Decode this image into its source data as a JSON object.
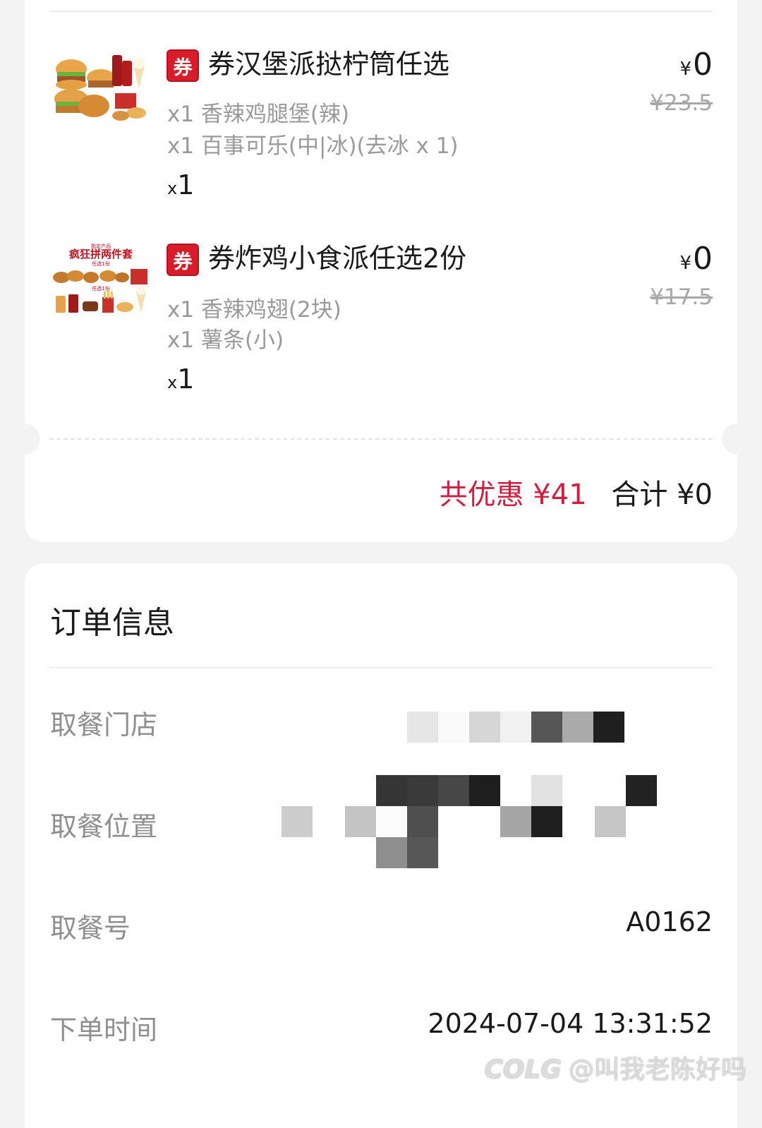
{
  "order_items": [
    {
      "badge": "券",
      "name": "券汉堡派挞柠筒任选",
      "price_symbol": "¥",
      "price": "0",
      "original_price": "¥23.5",
      "details": [
        "x1 香辣鸡腿堡(辣)",
        "x1 百事可乐(中|冰)(去冰 x 1)"
      ],
      "qty_prefix": "x",
      "qty": "1"
    },
    {
      "badge": "券",
      "name": "券炸鸡小食派任选2份",
      "price_symbol": "¥",
      "price": "0",
      "original_price": "¥17.5",
      "details": [
        "x1 香辣鸡翅(2块)",
        "x1 薯条(小)"
      ],
      "qty_prefix": "x",
      "qty": "1",
      "thumb_title": "疯狂拼两件套",
      "thumb_top_text": "指定产品",
      "thumb_sub_1": "任选1份",
      "thumb_sub_2": "任选1份"
    }
  ],
  "summary": {
    "discount": "共优惠 ¥41",
    "total": "合计 ¥0"
  },
  "order_info": {
    "title": "订单信息",
    "store_label": "取餐门店",
    "location_label": "取餐位置",
    "number_label": "取餐号",
    "number_value": "A0162",
    "time_label": "下单时间",
    "time_value": "2024-07-04 13:31:52"
  },
  "watermark": {
    "logo": "COLG",
    "text": "@叫我老陈好吗"
  },
  "colors": {
    "accent_red": "#d91c2a",
    "discount_red": "#d21d3c",
    "background": "#f3f3f3"
  }
}
